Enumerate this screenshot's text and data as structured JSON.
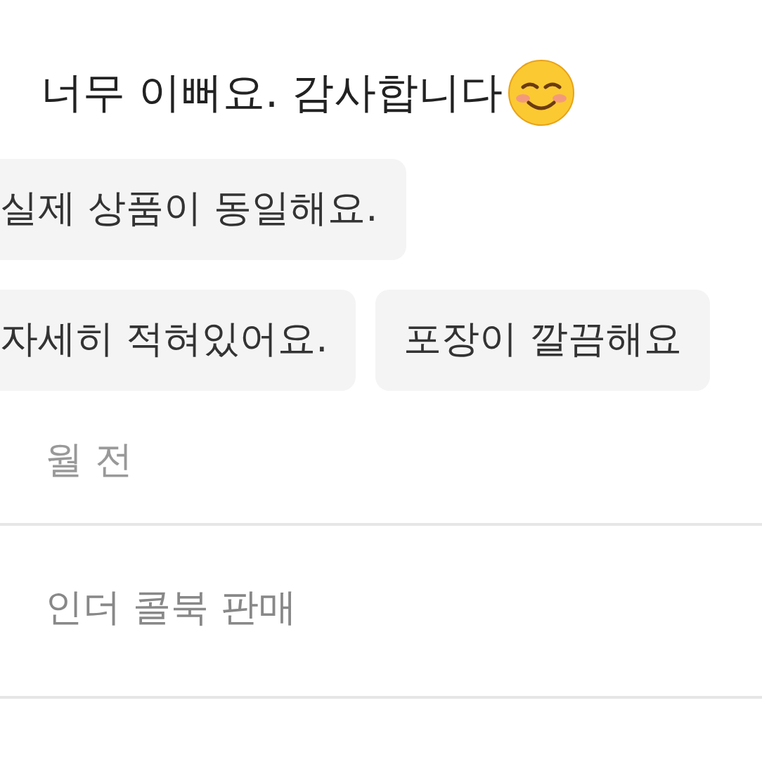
{
  "review": {
    "text": "너무 이뻐요. 감사합니다"
  },
  "tag_rows": [
    [
      "실제 상품이 동일해요."
    ],
    [
      "자세히 적혀있어요.",
      "포장이 깔끔해요"
    ]
  ],
  "time": "월 전",
  "seller": "인더 콜북 판매"
}
